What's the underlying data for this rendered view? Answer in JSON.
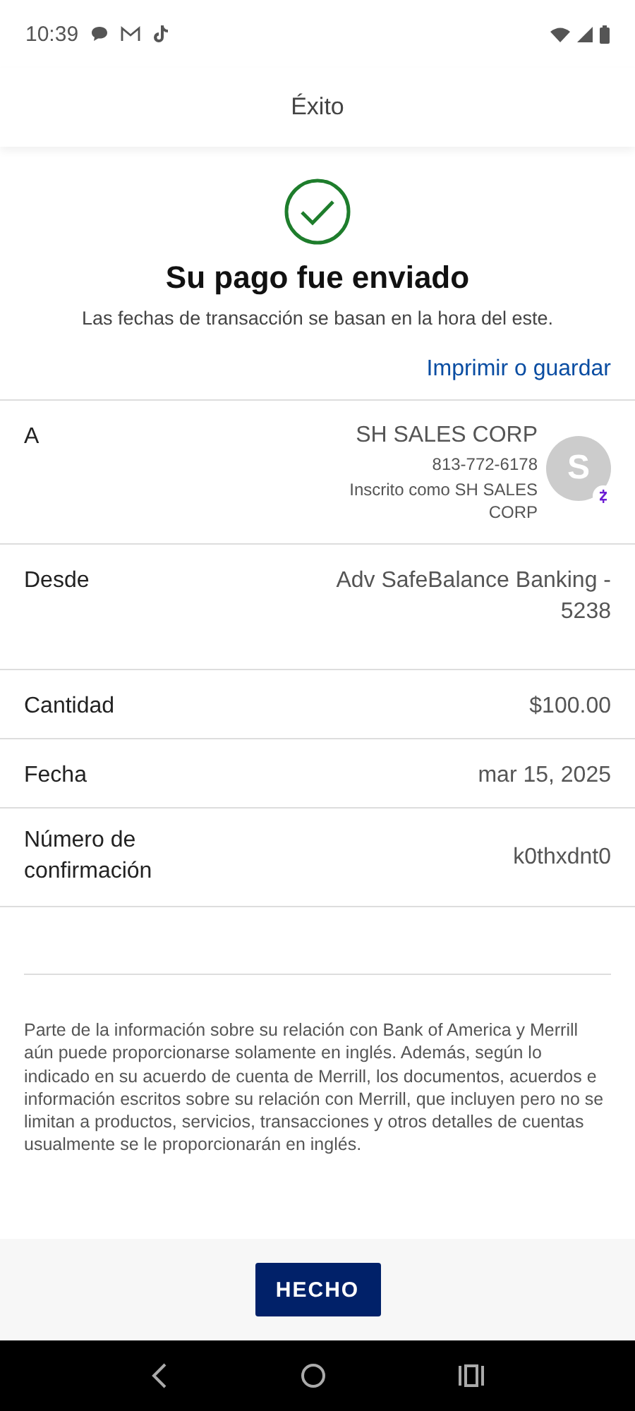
{
  "status_bar": {
    "time": "10:39"
  },
  "header": {
    "title": "Éxito"
  },
  "confirmation": {
    "title": "Su pago fue enviado",
    "subtitle": "Las fechas de transacción se basan en la hora del este.",
    "link": "Imprimir o guardar"
  },
  "details": [
    {
      "kind": "recipient",
      "label": "A",
      "name": "SH SALES CORP",
      "phone": "813-772-6178",
      "note": "Inscrito como SH SALES CORP",
      "avatar": "S"
    },
    {
      "kind": "plain",
      "label": "Desde",
      "value": "Adv SafeBalance Banking - 5238"
    },
    {
      "kind": "plain",
      "label": "Cantidad",
      "value": "$100.00"
    },
    {
      "kind": "plain",
      "label": "Fecha",
      "value": "mar 15, 2025"
    },
    {
      "kind": "plain",
      "label": "Número de confirmación",
      "value": "k0thxdnt0"
    }
  ],
  "disclaimer": "Parte de la información sobre su relación con Bank of America y Merrill aún puede proporcionarse solamente en inglés. Además, según lo indicado en su acuerdo de cuenta de Merrill, los documentos, acuerdos e información escritos sobre su relación con Merrill, que incluyen pero no se limitan a productos, servicios, transacciones y otros detalles de cuentas usualmente se le proporcionarán en inglés.",
  "button": "HECHO"
}
